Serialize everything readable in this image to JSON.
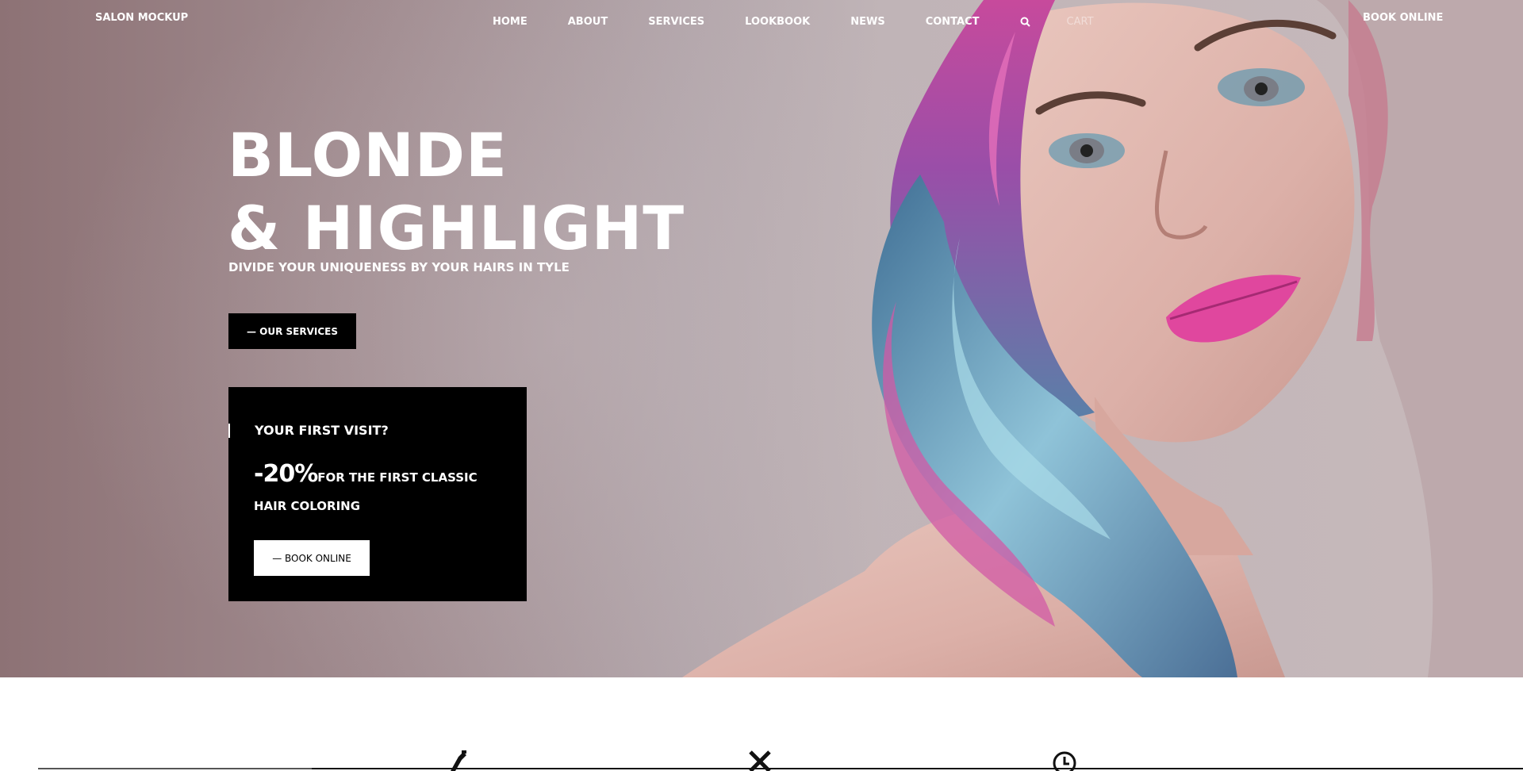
{
  "nav": {
    "logo": "SALON MOCKUP",
    "items": [
      "HOME",
      "ABOUT",
      "SERVICES",
      "LOOKBOOK",
      "NEWS",
      "CONTACT"
    ],
    "cart": "CART",
    "book_online": "BOOK ONLINE"
  },
  "hero": {
    "title_line1": "BLONDE",
    "title_line2": "& HIGHLIGHT",
    "subtitle": "DIVIDE YOUR UNIQUENESS BY YOUR HAIRS IN TYLE",
    "services_button": "— OUR SERVICES"
  },
  "promo": {
    "question": "YOUR FIRST VISIT?",
    "discount": "-20%",
    "offer_text": "FOR THE FIRST CLASSIC HAIR COLORING",
    "book_button": "— BOOK ONLINE"
  },
  "features": {
    "icons": [
      "hair-dryer-icon",
      "scissors-icon",
      "clock-icon"
    ]
  },
  "colors": {
    "promo_bg": "#000000",
    "hero_bg": "#b3a6ab"
  }
}
